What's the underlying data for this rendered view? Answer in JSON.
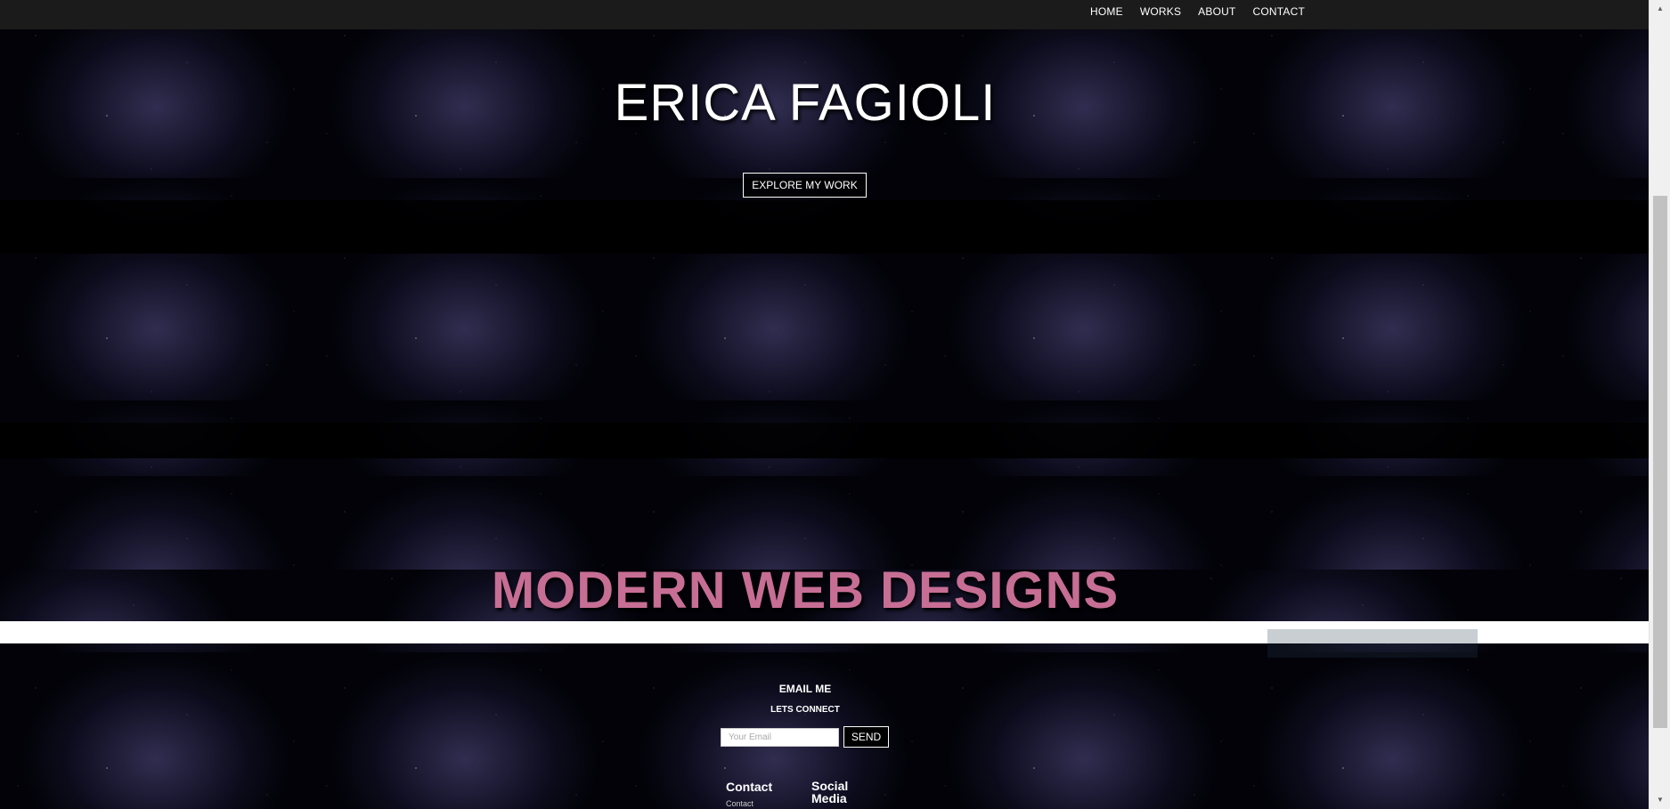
{
  "nav": {
    "items": [
      {
        "label": "HOME"
      },
      {
        "label": "WORKS"
      },
      {
        "label": "ABOUT"
      },
      {
        "label": "CONTACT"
      }
    ]
  },
  "hero": {
    "title": "ERICA FAGIOLI",
    "button_label": "EXPLORE MY WORK"
  },
  "section": {
    "title": "MODERN WEB DESIGNS"
  },
  "email": {
    "heading": "EMAIL ME",
    "subheading": "LETS CONNECT",
    "input_placeholder": "Your Email",
    "send_label": "SEND"
  },
  "footer": {
    "contact_heading": "Contact",
    "contact_sub": "Contact",
    "social_heading": "Social Media"
  },
  "colors": {
    "navbar": "#1b1b1b",
    "accent_pink": "#c76e95",
    "background": "#020208"
  },
  "icons": {
    "scroll_up": "scroll-up-arrow-icon",
    "scroll_down": "scroll-down-arrow-icon"
  }
}
